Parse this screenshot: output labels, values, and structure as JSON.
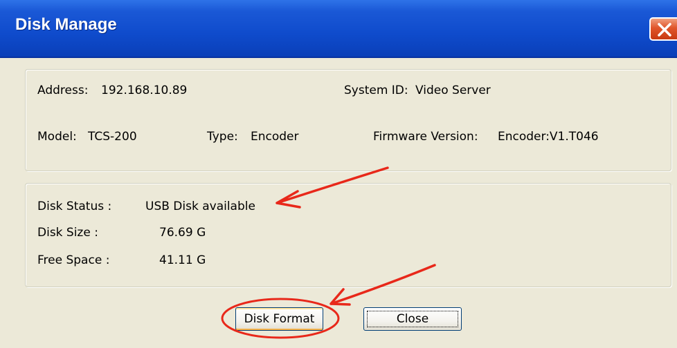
{
  "window": {
    "title": "Disk Manage"
  },
  "device_info": {
    "address_label": "Address:",
    "address_value": "192.168.10.89",
    "system_id_label": "System ID:",
    "system_id_value": "Video Server",
    "model_label": "Model:",
    "model_value": "TCS-200",
    "type_label": "Type:",
    "type_value": "Encoder",
    "firmware_label": "Firmware Version:",
    "firmware_value": "Encoder:V1.T046"
  },
  "disk_info": {
    "status_label": "Disk Status :",
    "status_value": "USB Disk available",
    "size_label": "Disk Size :",
    "size_value": "76.69 G",
    "free_label": "Free Space :",
    "free_value": "41.11 G"
  },
  "buttons": {
    "format_label": "Disk Format",
    "close_label": "Close"
  },
  "annotations": {
    "color": "#e8281a"
  }
}
